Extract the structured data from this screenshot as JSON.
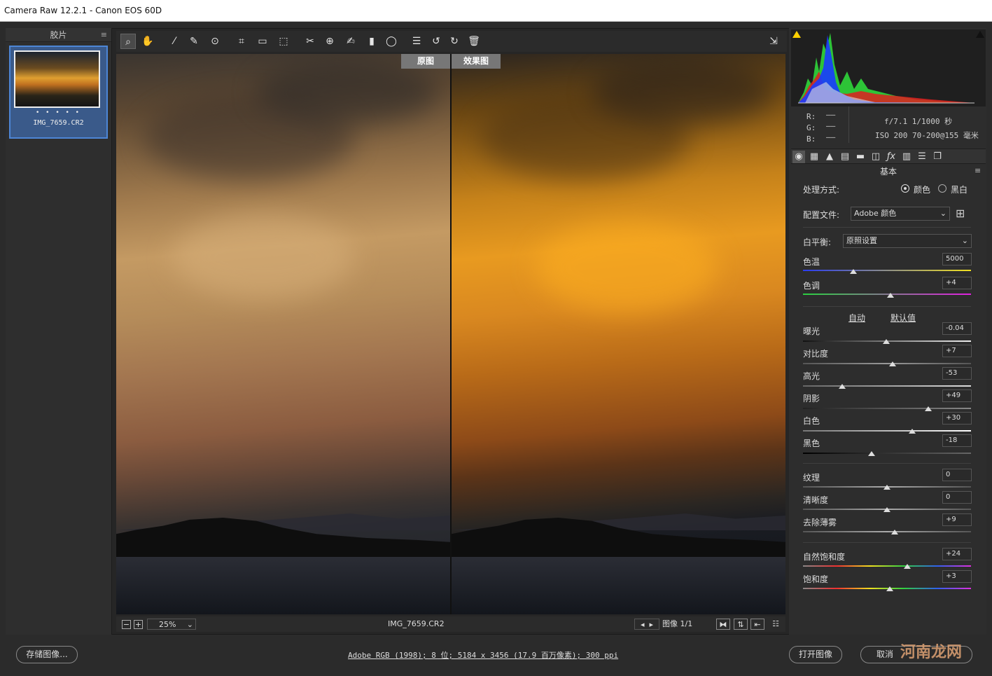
{
  "window": {
    "title": "Camera Raw 12.2.1 -  Canon EOS 60D"
  },
  "filmstrip": {
    "title": "胶片",
    "menu_icon": "menu-icon",
    "items": [
      {
        "name": "IMG_7659.CR2",
        "rating": "• • • • •"
      }
    ]
  },
  "toolbar": {
    "icons": [
      "zoom-icon",
      "hand-icon",
      "white-balance-icon",
      "color-sampler-icon",
      "targeted-adjust-icon",
      "crop-icon",
      "straighten-icon",
      "transform-icon",
      "spot-removal-icon",
      "red-eye-icon",
      "adjustment-brush-icon",
      "graduated-filter-icon",
      "radial-filter-icon",
      "preferences-icon",
      "rotate-left-icon",
      "rotate-right-icon",
      "trash-icon",
      "fullscreen-icon"
    ]
  },
  "viewer": {
    "before_label": "原图",
    "after_label": "效果图"
  },
  "bottombar": {
    "zoom": "25%",
    "filename": "IMG_7659.CR2",
    "image_label": "图像 1/1"
  },
  "histogram": {
    "shadow_clip_icon": "triangle-icon",
    "highlight_clip_icon": "triangle-icon"
  },
  "info": {
    "r": "R:",
    "g": "G:",
    "b": "B:",
    "dash": "——",
    "aperture_shutter": "f/7.1  1/1000 秒",
    "iso_lens": "ISO 200  70-200@155 毫米"
  },
  "panel": {
    "title": "基本",
    "process_label": "处理方式:",
    "process_color": "颜色",
    "process_bw": "黑白",
    "profile_label": "配置文件:",
    "profile_value": "Adobe 颜色",
    "wb_label": "白平衡:",
    "wb_value": "原照设置",
    "temp_label": "色温",
    "temp_value": "5000",
    "tint_label": "色调",
    "tint_value": "+4",
    "auto": "自动",
    "default": "默认值",
    "exposure_label": "曝光",
    "exposure_value": "-0.04",
    "contrast_label": "对比度",
    "contrast_value": "+7",
    "highlights_label": "高光",
    "highlights_value": "-53",
    "shadows_label": "阴影",
    "shadows_value": "+49",
    "whites_label": "白色",
    "whites_value": "+30",
    "blacks_label": "黑色",
    "blacks_value": "-18",
    "texture_label": "纹理",
    "texture_value": "0",
    "clarity_label": "清晰度",
    "clarity_value": "0",
    "dehaze_label": "去除薄雾",
    "dehaze_value": "+9",
    "vibrance_label": "自然饱和度",
    "vibrance_value": "+24",
    "saturation_label": "饱和度",
    "saturation_value": "+3"
  },
  "footer": {
    "save_label": "存储图像...",
    "info_link": "Adobe RGB (1998); 8 位; 5184 x 3456 (17.9 百万像素); 300 ppi",
    "open_label": "打开图像",
    "cancel_label": "取消",
    "watermark": "河南龙网"
  }
}
